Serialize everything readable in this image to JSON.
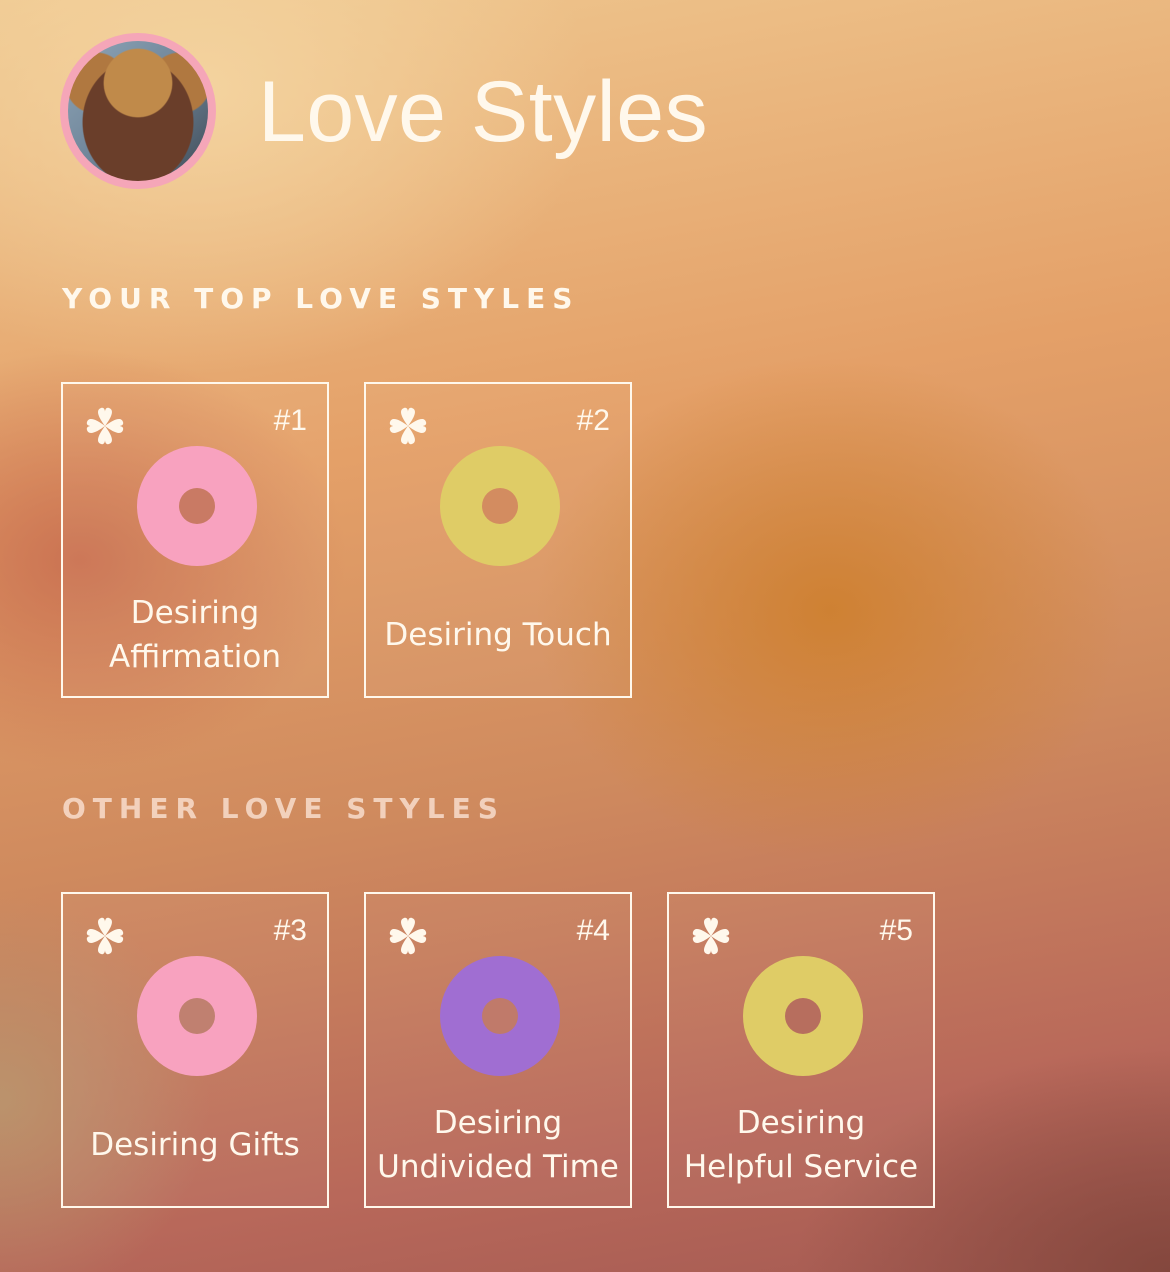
{
  "header": {
    "title": "Love Styles",
    "avatar_ring_color": "#f5a6b8"
  },
  "top_section": {
    "label": "YOUR TOP LOVE STYLES",
    "cards": [
      {
        "rank": "#1",
        "label": "Desiring Affirmation",
        "icon": "clover-icon",
        "donut_color": "#f8a2bf"
      },
      {
        "rank": "#2",
        "label": "Desiring Touch",
        "icon": "clover-icon",
        "donut_color": "#dfcc66"
      }
    ]
  },
  "other_section": {
    "label": "OTHER LOVE STYLES",
    "cards": [
      {
        "rank": "#3",
        "label": "Desiring Gifts",
        "icon": "clover-icon",
        "donut_color": "#f8a2bf"
      },
      {
        "rank": "#4",
        "label": "Desiring Undivided Time",
        "icon": "clover-icon",
        "donut_color": "#a06ed2"
      },
      {
        "rank": "#5",
        "label": "Desiring Helpful Service",
        "icon": "clover-icon",
        "donut_color": "#dfcc66"
      }
    ]
  }
}
